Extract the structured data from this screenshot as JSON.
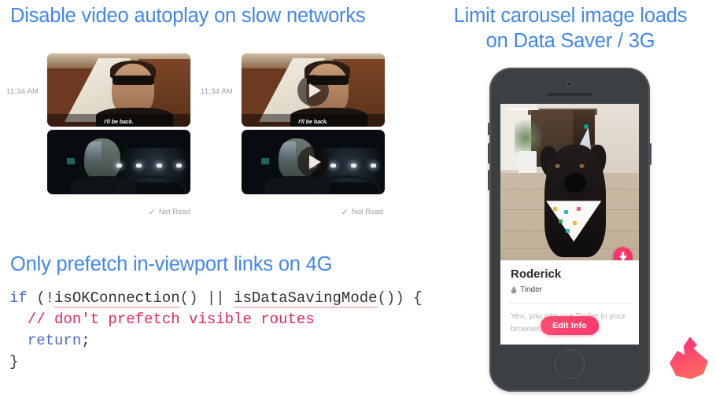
{
  "slide": {
    "titles": {
      "left": "Disable video autoplay on slow networks",
      "right_line1": "Limit carousel image loads",
      "right_line2": "on Data Saver / 3G",
      "code_section": "Only prefetch in-viewport links on 4G"
    },
    "accent_color": "#4186f5"
  },
  "chat": {
    "left": {
      "timestamp": "11:34 AM",
      "caption": "I'll be back.",
      "status": "Not Read",
      "status_icon": "check-icon",
      "autoplay": true
    },
    "right": {
      "timestamp": "11:34 AM",
      "caption": "I'll be back.",
      "status": "Not Read",
      "status_icon": "check-icon",
      "autoplay": false,
      "play_icon": "play-icon"
    }
  },
  "code": {
    "line1": {
      "kw_if": "if",
      "open": " (!",
      "fn1": "isOKConnection",
      "mid": "() || ",
      "fn2": "isDataSavingMode",
      "close": "()) {"
    },
    "line2_comment": "  // don't prefetch visible routes",
    "line3_kw": "  return",
    "line3_semi": ";",
    "line4": "}",
    "colors": {
      "keyword": "#4f6bd6",
      "comment": "#e8245c",
      "identifier": "#2b3036",
      "underline": "#f0868f"
    }
  },
  "phone": {
    "card": {
      "name": "Roderick",
      "source": "Tinder",
      "source_icon": "flame-icon",
      "body": "Yes, you can use Tinder in your browser, no app needed.",
      "edit_label": "Edit Info",
      "download_icon": "download-arrow-icon",
      "accent": "#fe3c72"
    },
    "hardware": {
      "camera_icon": "front-camera-icon",
      "speaker_icon": "earpiece-speaker-icon",
      "home_icon": "home-button-icon"
    }
  },
  "brand": {
    "logo_name": "tinder-flame-logo",
    "gradient_start": "#fd2d7d",
    "gradient_end": "#ff6b5a"
  }
}
